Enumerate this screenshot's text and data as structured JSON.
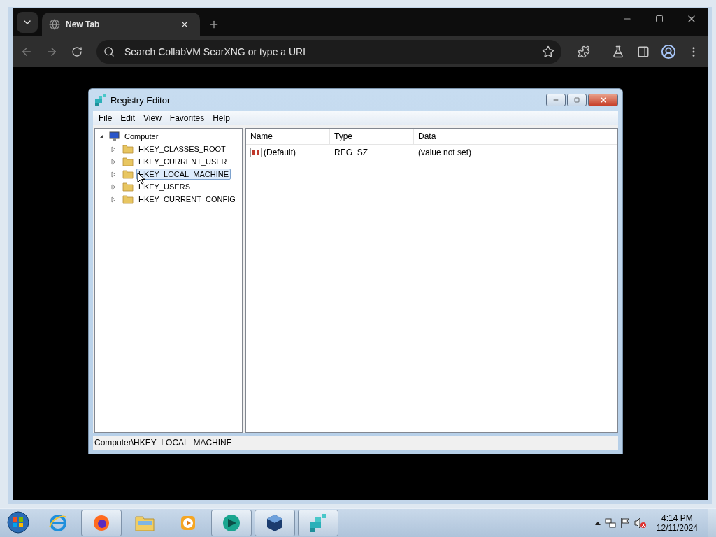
{
  "browser": {
    "tabs": [
      {
        "title": "New Tab",
        "selected": true
      }
    ],
    "omnibox": {
      "placeholder": "Search CollabVM SearXNG or type a URL"
    }
  },
  "registry_editor": {
    "title": "Registry Editor",
    "menu": [
      "File",
      "Edit",
      "View",
      "Favorites",
      "Help"
    ],
    "tree": [
      {
        "label": "Computer",
        "expanded": true,
        "selected": false,
        "children": [
          {
            "label": "HKEY_CLASSES_ROOT",
            "expanded": false,
            "selected": false
          },
          {
            "label": "HKEY_CURRENT_USER",
            "expanded": false,
            "selected": false
          },
          {
            "label": "HKEY_LOCAL_MACHINE",
            "expanded": false,
            "selected": true
          },
          {
            "label": "HKEY_USERS",
            "expanded": false,
            "selected": false
          },
          {
            "label": "HKEY_CURRENT_CONFIG",
            "expanded": false,
            "selected": false
          }
        ]
      }
    ],
    "list": {
      "columns": [
        "Name",
        "Type",
        "Data"
      ],
      "rows": [
        [
          "(Default)",
          "REG_SZ",
          "(value not set)"
        ]
      ]
    },
    "status_bar": "Computer\\HKEY_LOCAL_MACHINE"
  },
  "taskbar": {
    "apps": [
      {
        "kind": "ie",
        "running": false
      },
      {
        "kind": "firefox",
        "running": true
      },
      {
        "kind": "explorer",
        "running": false
      },
      {
        "kind": "media",
        "running": false
      },
      {
        "kind": "teal",
        "running": true
      },
      {
        "kind": "cube",
        "running": true
      },
      {
        "kind": "regedit",
        "running": true
      }
    ],
    "clock": {
      "time": "4:14 PM",
      "date": "12/11/2024"
    }
  }
}
